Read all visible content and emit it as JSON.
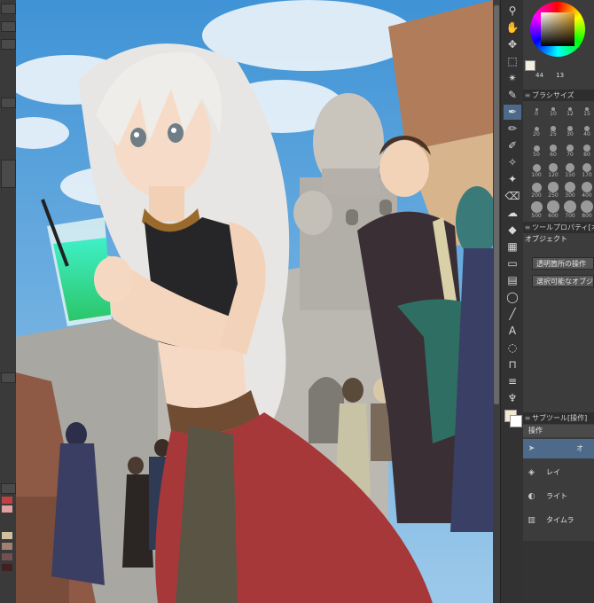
{
  "colors": {
    "sky": "#5aa6de",
    "accent_selection": "#4d6a8a",
    "panel_bg": "#3c3c3c"
  },
  "left_panel": {
    "palette_swatches": [
      "#c04040",
      "#e0a0a0",
      "#d0c0a0",
      "#a08070",
      "#705050",
      "#402020"
    ]
  },
  "toolbar": {
    "tools": [
      {
        "name": "zoom-icon",
        "glyph": "⚲"
      },
      {
        "name": "hand-icon",
        "glyph": "✋"
      },
      {
        "name": "move-icon",
        "glyph": "✥"
      },
      {
        "name": "selection-rect-icon",
        "glyph": "⬚"
      },
      {
        "name": "magic-wand-icon",
        "glyph": "✴"
      },
      {
        "name": "eyedropper-icon",
        "glyph": "✎"
      },
      {
        "name": "pen-icon",
        "glyph": "✒"
      },
      {
        "name": "pencil-icon",
        "glyph": "✏"
      },
      {
        "name": "brush-icon",
        "glyph": "✐"
      },
      {
        "name": "airbrush-icon",
        "glyph": "✧"
      },
      {
        "name": "decoration-icon",
        "glyph": "✦"
      },
      {
        "name": "eraser-icon",
        "glyph": "⌫"
      },
      {
        "name": "blend-icon",
        "glyph": "☁"
      },
      {
        "name": "fill-icon",
        "glyph": "◆"
      },
      {
        "name": "gradient-icon",
        "glyph": "▦"
      },
      {
        "name": "figure-icon",
        "glyph": "▭"
      },
      {
        "name": "frame-icon",
        "glyph": "▤"
      },
      {
        "name": "balloon-icon",
        "glyph": "◯"
      },
      {
        "name": "line-icon",
        "glyph": "╱"
      },
      {
        "name": "text-icon",
        "glyph": "A"
      },
      {
        "name": "speech-balloon-icon",
        "glyph": "◌"
      },
      {
        "name": "ruler-icon",
        "glyph": "⊓"
      },
      {
        "name": "correct-line-icon",
        "glyph": "≡"
      },
      {
        "name": "fan-icon",
        "glyph": "♆"
      }
    ],
    "main_color": "#f0e8d0",
    "sub_color": "#ffffff"
  },
  "color_wheel": {
    "main_color": "#f4f0e0",
    "value_left": "44",
    "value_right": "13"
  },
  "brush_size_panel": {
    "title": "ブラシサイズ",
    "sizes": [
      "0",
      "10",
      "12",
      "15",
      "20",
      "25",
      "30",
      "40",
      "50",
      "60",
      "70",
      "80",
      "100",
      "120",
      "150",
      "170",
      "200",
      "250",
      "300",
      "400",
      "500",
      "600",
      "700",
      "800"
    ]
  },
  "tool_property_panel": {
    "title": "ツールプロパティ[オブジェクト]",
    "tool_name": "オブジェクト",
    "buttons": [
      "透明箇所の操作",
      "選択可能なオブジェ"
    ]
  },
  "subtool_panel": {
    "title": "サブツール[操作]",
    "group_name": "操作",
    "items": [
      {
        "name": "object",
        "label": "オ",
        "icon": "cursor-icon"
      },
      {
        "name": "layer-select",
        "label": "レイ",
        "icon": "layer-select-icon"
      },
      {
        "name": "light-table",
        "label": "ライト",
        "icon": "light-table-icon"
      },
      {
        "name": "timeline",
        "label": "タイムラ",
        "icon": "timeline-icon"
      }
    ]
  }
}
